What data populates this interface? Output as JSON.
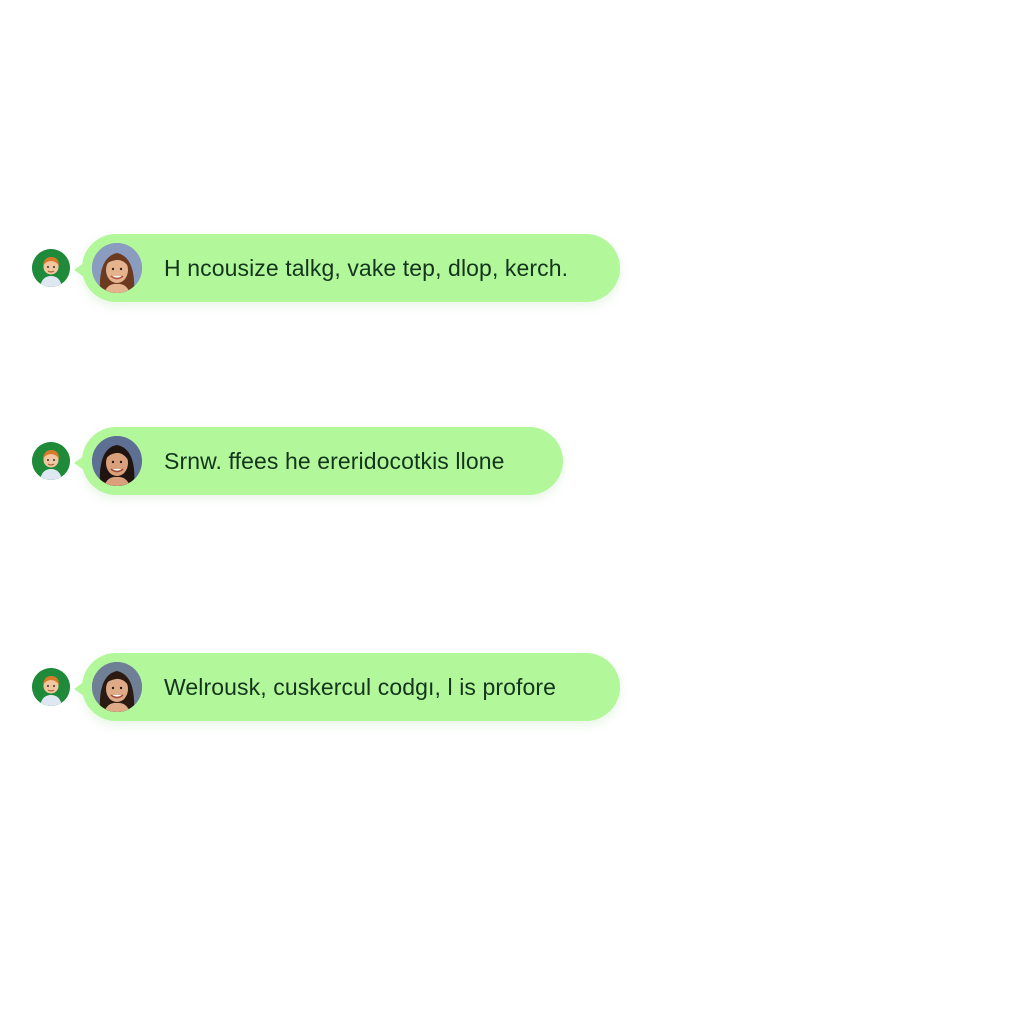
{
  "colors": {
    "bubble": "#b2f79a",
    "small_avatar_bg": "#1f8a3a",
    "text": "#14351d"
  },
  "messages": [
    {
      "sender_icon": "cartoon-person-avatar",
      "photo_icon": "woman-portrait-avatar",
      "text": "H ncousize talkg, vake tep, dlop, kerch."
    },
    {
      "sender_icon": "cartoon-person-avatar",
      "photo_icon": "woman-portrait-avatar",
      "text": "Srnw. ffees he ereridocotkis llone"
    },
    {
      "sender_icon": "cartoon-person-avatar",
      "photo_icon": "woman-portrait-avatar",
      "text": "Welrousk, cuskercul codgı, l is profore"
    }
  ]
}
